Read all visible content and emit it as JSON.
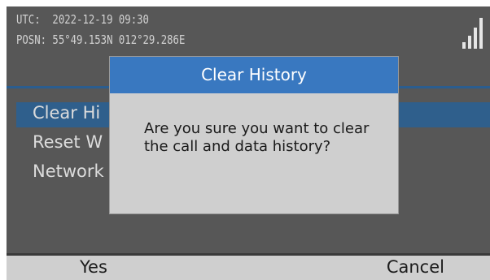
{
  "status": {
    "utc_label": "UTC:",
    "utc_value": "2022-12-19 09:30",
    "posn_label": "POSN:",
    "posn_value": "55°49.153N 012°29.286E",
    "signal_bars": 4
  },
  "menu": {
    "items": [
      {
        "label": "Clear Hi"
      },
      {
        "label": "Reset W"
      },
      {
        "label": "Network"
      }
    ],
    "selected_index": 0
  },
  "dialog": {
    "title": "Clear History",
    "message": "Are you sure you want to clear the call and data history?"
  },
  "softkeys": {
    "left": "Yes",
    "right": "Cancel"
  },
  "colors": {
    "accent": "#3978c0",
    "selection": "#2f5f8c",
    "screen_bg": "#575757",
    "dialog_bg": "#cfcfcf"
  }
}
